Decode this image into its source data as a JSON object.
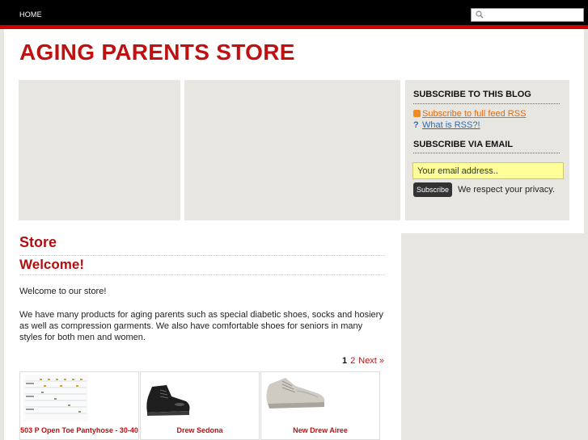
{
  "nav": {
    "home_label": "HOME"
  },
  "search": {
    "placeholder": ""
  },
  "site": {
    "title": "AGING PARENTS STORE"
  },
  "sidebar": {
    "subscribe_blog_heading": "SUBSCRIBE TO THIS BLOG",
    "rss_link": "Subscribe to full feed RSS",
    "what_is_rss": "What is RSS?!",
    "subscribe_email_heading": "SUBSCRIBE VIA EMAIL",
    "email_placeholder": "Your email address..",
    "subscribe_button": "Subscribe",
    "privacy_note": "We respect your privacy."
  },
  "main": {
    "heading": "Store",
    "subheading": "Welcome!",
    "intro": "Welcome to our store!",
    "body": "We have many products for aging parents such as special diabetic shoes, socks and hosiery as well as compression garments.  We also have comfortable shoes for seniors in many styles for both men and women."
  },
  "pagination": {
    "current": "1",
    "page2": "2",
    "next": "Next »"
  },
  "products": [
    {
      "name": "503 P Open Toe Pantyhose - 30-40"
    },
    {
      "name": "Drew Sedona"
    },
    {
      "name": "New Drew Airee"
    }
  ],
  "colors": {
    "brand_red": "#c01010",
    "accent_red": "#cc0000",
    "panel_bg": "#e8e6e0",
    "email_bg": "#ffff99"
  }
}
